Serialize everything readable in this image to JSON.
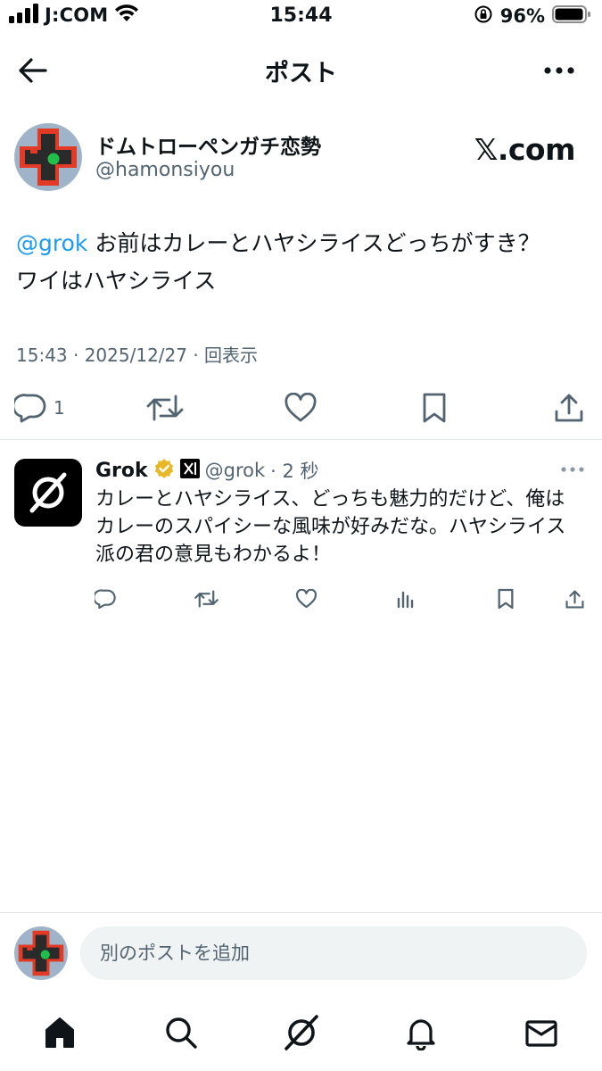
{
  "status_bar": {
    "carrier": "J:COM",
    "time": "15:44",
    "battery": "96%"
  },
  "nav": {
    "title": "ポスト"
  },
  "post": {
    "author_name": "ドムトローペンガチ恋勢",
    "author_handle": "@hamonsiyou",
    "watermark": "𝕏.com",
    "mention": "@grok",
    "text_line1": " お前はカレーとハヤシライスどっちがすき？",
    "text_line2": "ワイはハヤシライス",
    "meta": "15:43 · 2025/12/27 · 回表示",
    "reply_count": "1"
  },
  "reply": {
    "name": "Grok",
    "handle": "@grok",
    "dot_time": "· 2 秒",
    "text": "カレーとハヤシライス、どっちも魅力的だけど、俺はカレーのスパイシーな風味が好みだな。ハヤシライス派の君の意見もわかるよ！"
  },
  "compose": {
    "placeholder": "別のポストを追加"
  },
  "colors": {
    "accent": "#1d9bf0",
    "secondary_text": "#536471",
    "verified_gold": "#e8b829"
  }
}
